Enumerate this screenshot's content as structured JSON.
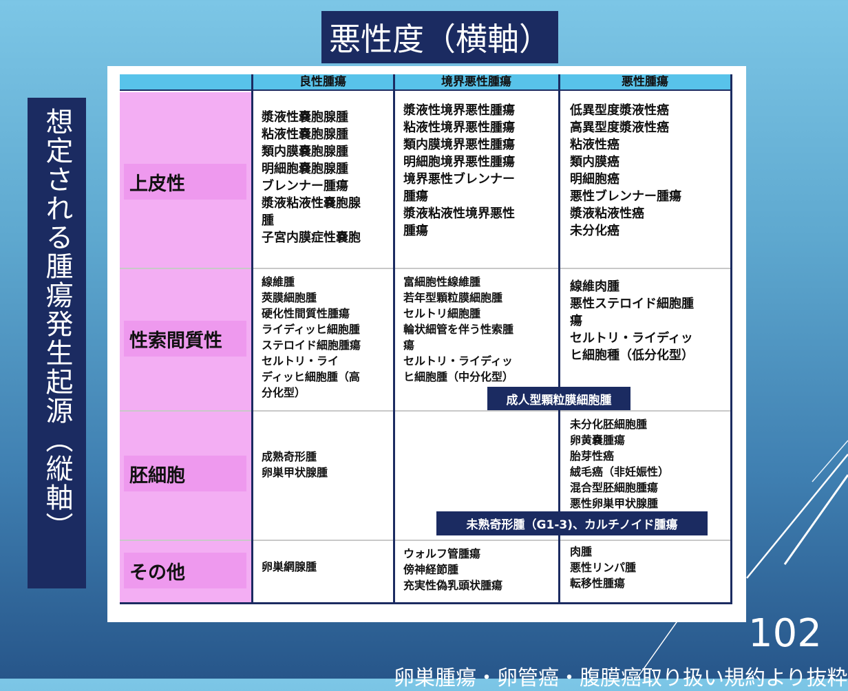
{
  "title": "悪性度（横軸）",
  "side_label": "想定される腫瘍発生起源（縦軸）",
  "page_number": "102",
  "footer": "卵巣腫瘍・卵管癌・腹膜癌取り扱い規約より抜粋",
  "table": {
    "headers": [
      "良性腫瘍",
      "境界悪性腫瘍",
      "悪性腫瘍"
    ],
    "rows": [
      {
        "label": "上皮性",
        "benign": "漿液性嚢胞腺腫\n粘液性嚢胞腺腫\n類内膜嚢胞腺腫\n明細胞嚢胞腺腫\nブレンナー腫瘍\n漿液粘液性嚢胞腺\n腫\n子宮内膜症性嚢胞",
        "borderline": "漿液性境界悪性腫瘍\n粘液性境界悪性腫瘍\n類内膜境界悪性腫瘍\n明細胞境界悪性腫瘍\n境界悪性ブレンナー\n腫瘍\n漿液粘液性境界悪性\n腫瘍",
        "malignant": "低異型度漿液性癌\n高異型度漿液性癌\n粘液性癌\n類内膜癌\n明細胞癌\n悪性ブレンナー腫瘍\n漿液粘液性癌\n未分化癌"
      },
      {
        "label": "性索間質性",
        "benign": "線維腫\n莢膜細胞腫\n硬化性間質性腫瘍\nライディッヒ細胞腫\nステロイド細胞腫瘍\nセルトリ・ライ\nディッヒ細胞腫（高\n分化型）",
        "borderline": "富細胞性線維腫\n若年型顆粒膜細胞腫\nセルトリ細胞腫\n輪状細管を伴う性索腫\n瘍\nセルトリ・ライディッ\nヒ細胞腫（中分化型）",
        "malignant": "線維肉腫\n悪性ステロイド細胞腫\n瘍\nセルトリ・ライディッ\nヒ細胞種（低分化型）"
      },
      {
        "label": "胚細胞",
        "benign": "成熟奇形腫\n卵巣甲状腺腫",
        "borderline": "",
        "malignant": "未分化胚細胞腫\n卵黄嚢腫瘍\n胎芽性癌\n絨毛癌（非妊娠性）\n混合型胚細胞腫瘍\n悪性卵巣甲状腺腫"
      },
      {
        "label": "その他",
        "benign": "卵巣網腺腫",
        "borderline": "ウォルフ管腫瘍\n傍神経節腫\n充実性偽乳頭状腫瘍",
        "malignant": "肉腫\n悪性リンパ腫\n転移性腫瘍"
      }
    ],
    "banners": [
      "成人型顆粒膜細胞腫",
      "未熟奇形腫（G1-3)、カルチノイド腫瘍"
    ]
  },
  "colors": {
    "navy": "#1b2b61",
    "header": "#58c3ea",
    "pink": "#f3aef3",
    "pink_label": "#ee99ee"
  }
}
